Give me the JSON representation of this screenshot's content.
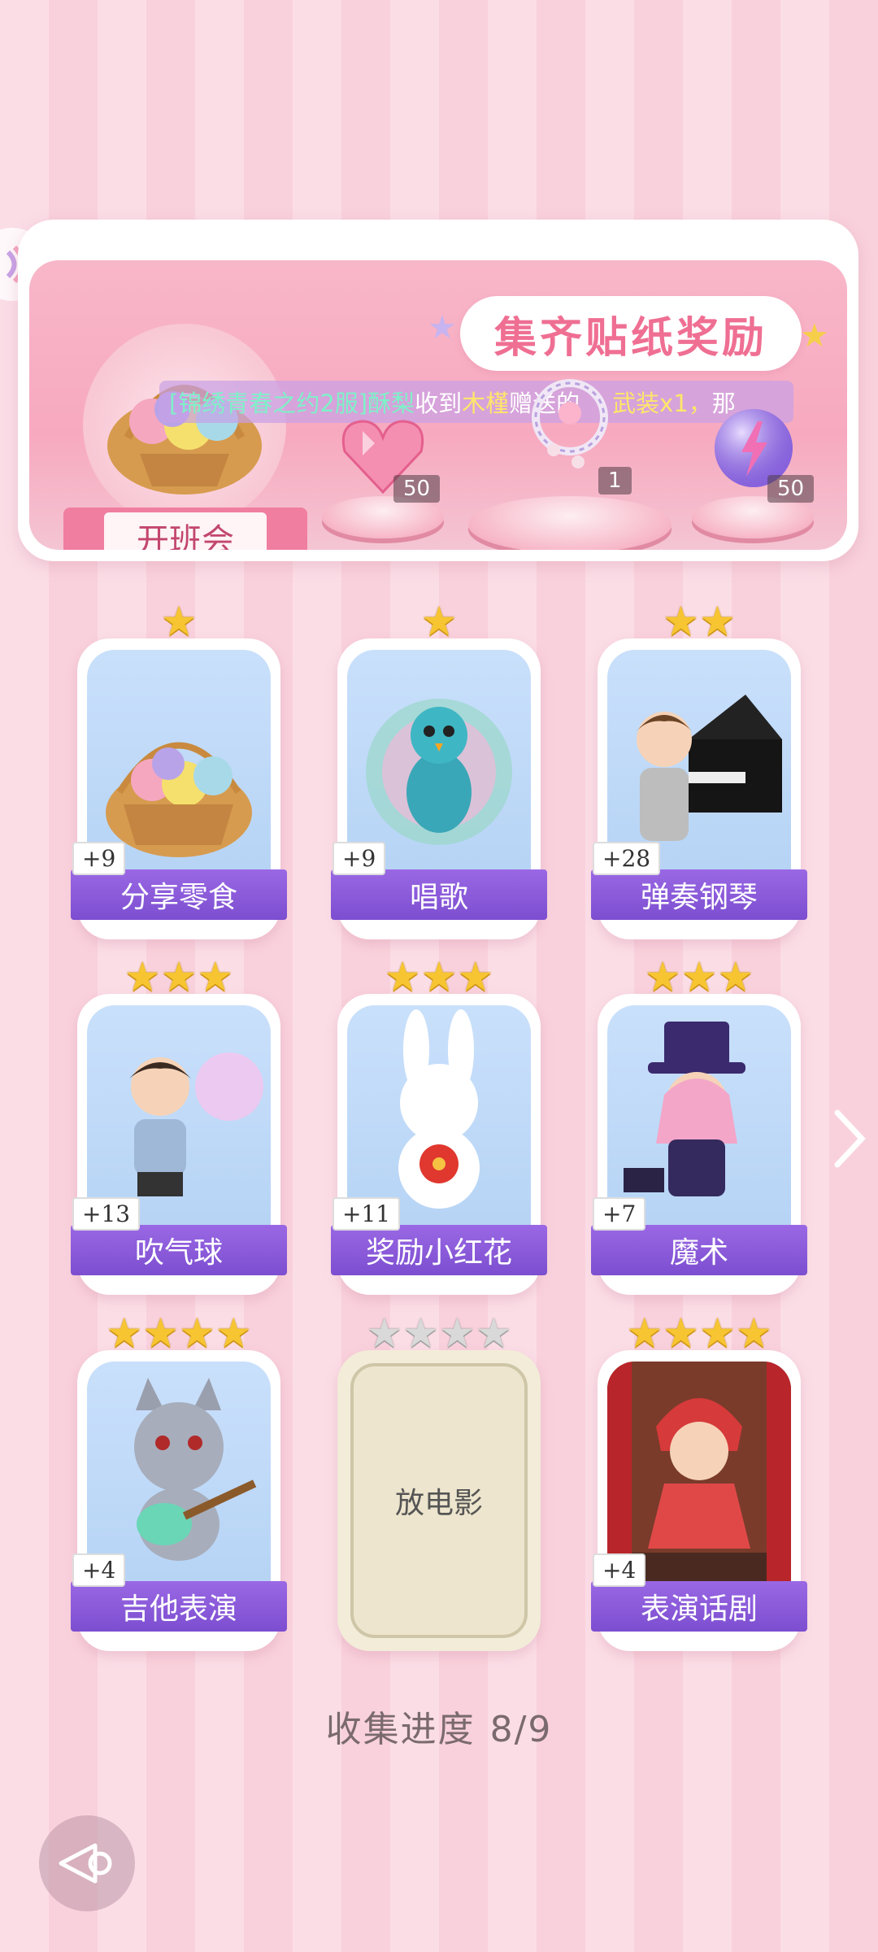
{
  "banner": {
    "title": "集齐贴纸奖励",
    "ticker_parts": [
      "[锦绣青春之约2服]",
      "酥梨",
      "收到",
      "木槿",
      "赠送的",
      "武装x1，",
      "那"
    ],
    "emblem_label": "开班会",
    "rewards": [
      {
        "icon": "pink-heart-gem-icon",
        "count": "50"
      },
      {
        "icon": "jeweled-ring-icon",
        "count": "1"
      },
      {
        "icon": "purple-lightning-orb-icon",
        "count": "50"
      }
    ]
  },
  "cards": [
    {
      "label": "分享零食",
      "plus": "+9",
      "stars": 1,
      "image": "snack-basket-icon"
    },
    {
      "label": "唱歌",
      "plus": "+9",
      "stars": 1,
      "image": "peacock-singing-icon"
    },
    {
      "label": "弹奏钢琴",
      "plus": "+28",
      "stars": 2,
      "image": "boy-piano-icon"
    },
    {
      "label": "吹气球",
      "plus": "+13",
      "stars": 3,
      "image": "boy-bubble-icon"
    },
    {
      "label": "奖励小红花",
      "plus": "+11",
      "stars": 3,
      "image": "bunny-flower-icon"
    },
    {
      "label": "魔术",
      "plus": "+7",
      "stars": 3,
      "image": "magician-girl-icon"
    },
    {
      "label": "吉他表演",
      "plus": "+4",
      "stars": 4,
      "image": "wolf-guitar-icon"
    },
    {
      "label": "放电影",
      "plus": "",
      "stars": 4,
      "image": "",
      "locked": true
    },
    {
      "label": "表演话剧",
      "plus": "+4",
      "stars": 4,
      "image": "cat-girl-stage-icon"
    }
  ],
  "progress": {
    "label": "收集进度",
    "value": "8/9"
  },
  "colors": {
    "accent": "#8a5cdc",
    "banner_title": "#ef6f93",
    "star": "#f7c531"
  }
}
